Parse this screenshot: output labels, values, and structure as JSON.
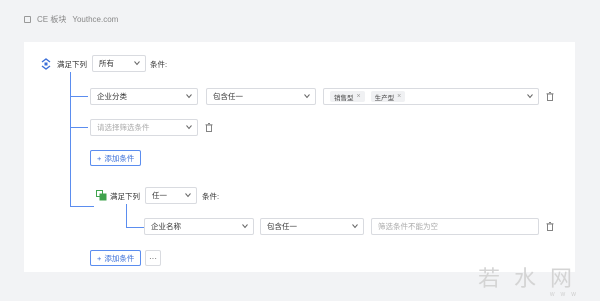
{
  "header": {
    "brand": "CE 板块",
    "site": "Youthce.com"
  },
  "root": {
    "label": "满足下列",
    "mode": "所有",
    "suffix": "条件:"
  },
  "row1": {
    "field": "企业分类",
    "operator": "包含任一",
    "tags": [
      "销售型",
      "生产型"
    ]
  },
  "row2": {
    "placeholder": "请选择筛选条件"
  },
  "add_condition_label": "添加条件",
  "group": {
    "label": "满足下列",
    "mode": "任一",
    "suffix": "条件:",
    "row": {
      "field": "企业名称",
      "operator": "包含任一",
      "value_placeholder": "筛选条件不能为空"
    }
  },
  "bottom": {
    "add_label": "添加条件",
    "more_label": "···"
  },
  "watermark": {
    "text": "若水网",
    "sub": "WWW"
  },
  "colors": {
    "accent": "#5b8def",
    "group_icon": "#3fa34d"
  }
}
